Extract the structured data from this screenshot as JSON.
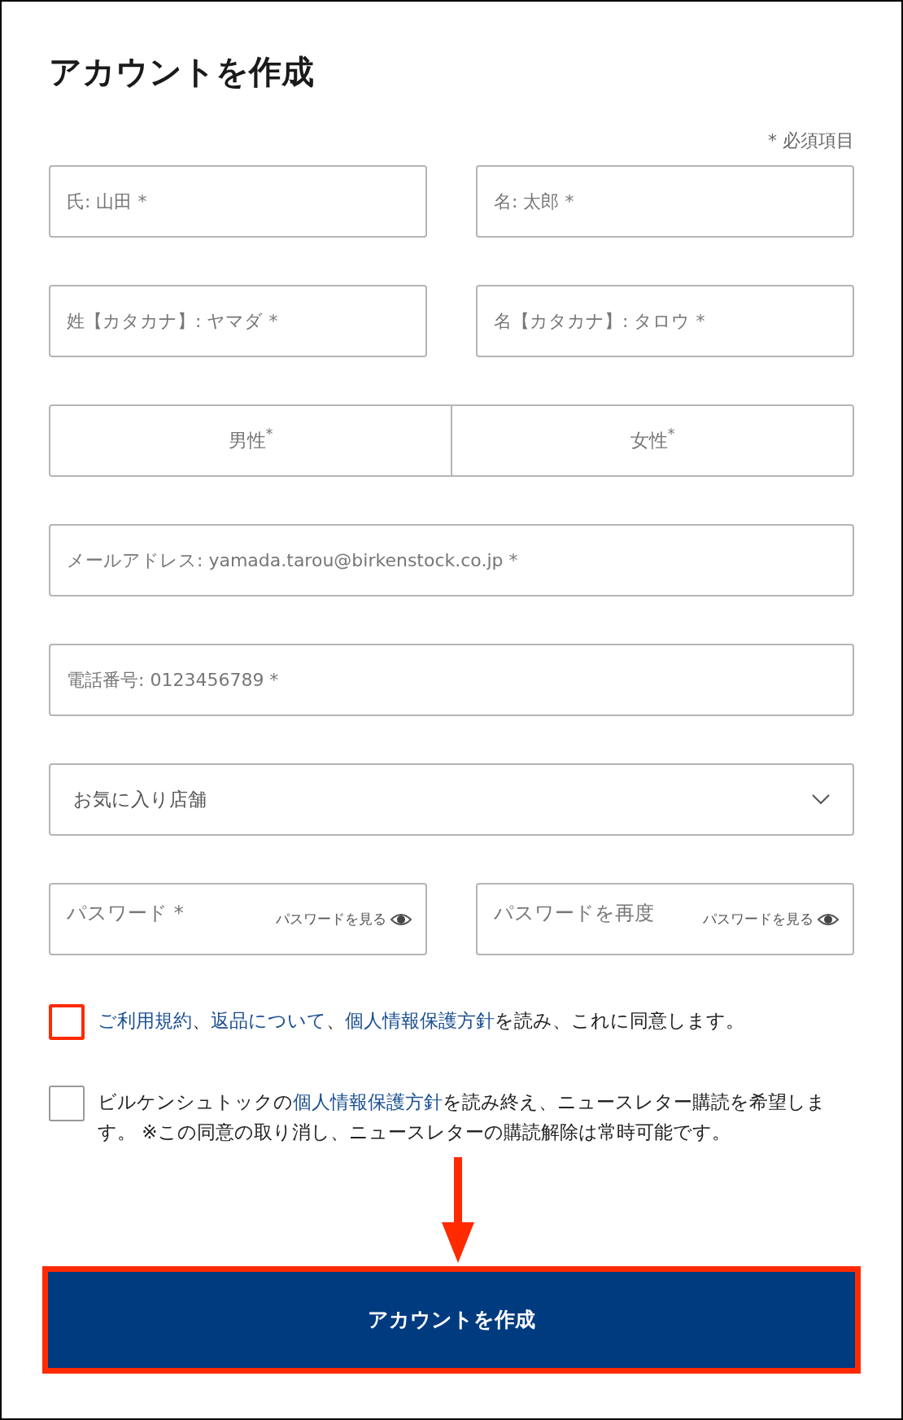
{
  "title": "アカウントを作成",
  "required_note": "* 必須項目",
  "field_rows": [
    {
      "kind": "pair",
      "fields": [
        {
          "placeholder": "氏: 山田 *"
        },
        {
          "placeholder": "名: 太郎 *"
        }
      ]
    },
    {
      "kind": "pair",
      "fields": [
        {
          "placeholder": "姓【カタカナ】: ヤマダ *"
        },
        {
          "placeholder": "名【カタカナ】: タロウ *"
        }
      ]
    },
    {
      "kind": "gender",
      "options": [
        {
          "label": "男性$^{*}$",
          "selected": false
        },
        {
          "label": "女性$^{*}$",
          "selected": false
        }
      ]
    },
    {
      "kind": "single",
      "fields": [
        {
          "placeholder": "メールアドレス: yamada.tarou@birkenstock.co.jp *"
        }
      ]
    },
    {
      "kind": "single",
      "fields": [
        {
          "placeholder": "電話番号: 0123456789 *"
        }
      ]
    },
    {
      "kind": "select",
      "fields": [
        {
          "placeholder": "お気に入り店舗"
        }
      ]
    },
    {
      "kind": "password",
      "fields": [
        {
          "placeholder": "パスワード *",
          "toggle": "パスワードを見る"
        },
        {
          "placeholder": "パスワードを再度",
          "toggle": "パスワードを見る"
        }
      ]
    }
  ],
  "consents": [
    {
      "checked": false,
      "highlighted": true,
      "parts": [
        {
          "text": "ご利用規約",
          "link": true
        },
        {
          "text": "、",
          "link": false
        },
        {
          "text": "返品について",
          "link": true
        },
        {
          "text": "、",
          "link": false
        },
        {
          "text": "個人情報保護方針",
          "link": true
        },
        {
          "text": "を読み、これに同意します。",
          "link": false
        }
      ]
    },
    {
      "checked": false,
      "highlighted": false,
      "parts": [
        {
          "text": "ビルケンシュトックの",
          "link": false
        },
        {
          "text": "個人情報保護方針",
          "link": true
        },
        {
          "text": "を読み終え、ニュースレター購読を希望します。 ※この同意の取り消し、ニュースレターの購読解除は常時可能です。",
          "link": false
        }
      ]
    }
  ],
  "submit": {
    "label": "アカウントを作成",
    "highlighted": true
  }
}
